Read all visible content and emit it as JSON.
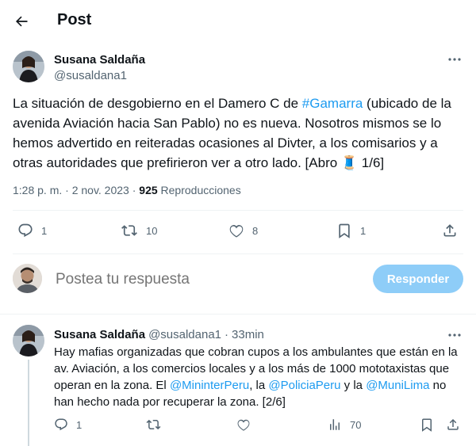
{
  "header": {
    "title": "Post"
  },
  "main_tweet": {
    "author_name": "Susana Saldaña",
    "author_handle": "@susaldana1",
    "text_before": "La situación de desgobierno en el Damero C de ",
    "hashtag": "#Gamarra",
    "text_after": " (ubicado de la avenida Aviación hacia San Pablo) no es nueva. Nosotros mismos se lo hemos advertido en reiteradas ocasiones al Divter, a los comisarios y a otras autoridades que prefirieron ver a otro lado. [Abro ",
    "emoji": "🧵",
    "text_end": " 1/6]",
    "time": "1:28 p. m. · 2 nov. 2023 · ",
    "views_count": "925",
    "views_label": " Reproducciones",
    "stats": {
      "replies": "1",
      "reposts": "10",
      "likes": "8",
      "bookmarks": "1"
    }
  },
  "reply_composer": {
    "placeholder": "Postea tu respuesta",
    "button_label": "Responder"
  },
  "reply_tweet": {
    "author_name": "Susana Saldaña",
    "author_handle": "@susaldana1",
    "separator": "·",
    "time": "33min",
    "text_1": "Hay mafias organizadas que cobran cupos a los ambulantes que están en la av. Aviación, a los comercios locales y a los más de 1000 mototaxistas que operan en la zona. El ",
    "mention_1": "@MininterPeru",
    "text_2": ", la ",
    "mention_2": "@PoliciaPeru",
    "text_3": " y la ",
    "mention_3": "@MuniLima",
    "text_4": " no han hecho nada por recuperar la zona. [2/6]",
    "stats": {
      "replies": "1",
      "views": "70"
    }
  },
  "colors": {
    "accent": "#1d9bf0",
    "muted": "#536471",
    "button_disabled": "#8ecdf8"
  }
}
